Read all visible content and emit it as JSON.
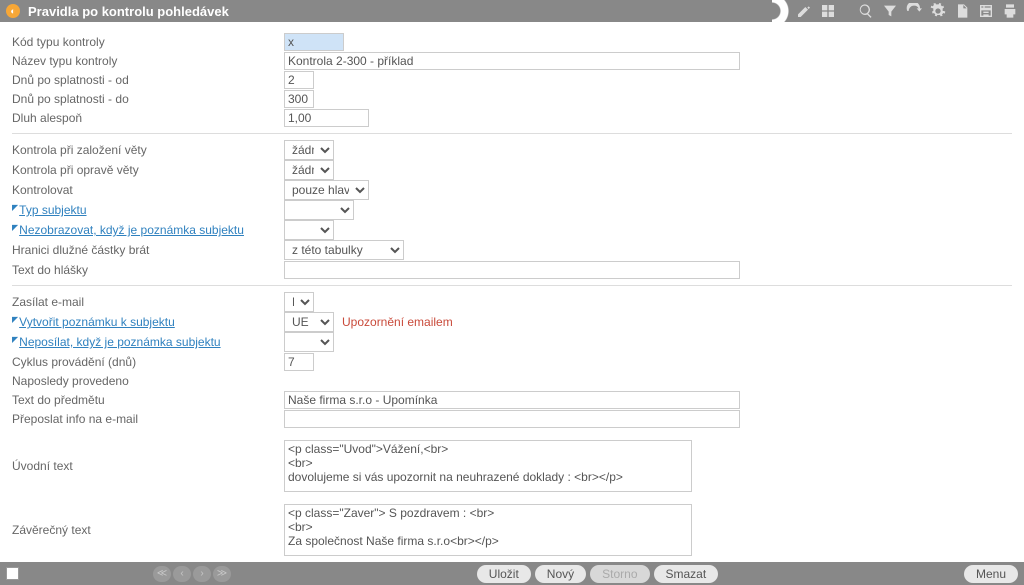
{
  "header": {
    "title": "Pravidla po kontrolu pohledávek"
  },
  "fields": {
    "kod_typu_label": "Kód typu kontroly",
    "kod_typu_value": "x",
    "nazev_typu_label": "Název typu kontroly",
    "nazev_typu_value": "Kontrola 2-300 - příklad",
    "dnu_od_label": "Dnů po splatnosti - od",
    "dnu_od_value": "2",
    "dnu_do_label": "Dnů po splatnosti - do",
    "dnu_do_value": "300",
    "dluh_label": "Dluh alespoň",
    "dluh_value": "1,00",
    "kontrola_zalozeni_label": "Kontrola při založení věty",
    "kontrola_zalozeni_value": "žádná",
    "kontrola_oprave_label": "Kontrola při opravě věty",
    "kontrola_oprave_value": "žádná",
    "kontrolovat_label": "Kontrolovat",
    "kontrolovat_value": "pouze hlavičky",
    "typ_subjektu_label": "Typ subjektu",
    "nezobrazovat_label": "Nezobrazovat, když je poznámka subjektu",
    "hranici_label": "Hranici dlužné částky brát",
    "hranici_value": "z této tabulky",
    "text_hlasky_label": "Text do hlášky",
    "text_hlasky_value": "",
    "zasilat_label": "Zasílat e-mail",
    "zasilat_value": "Ne",
    "vytvorit_label": "Vytvořit poznámku k subjektu",
    "vytvorit_value": "UE",
    "vytvorit_desc": "Upozornění emailem",
    "neposilat_label": "Neposílat, když je poznámka subjektu",
    "cyklus_label": "Cyklus provádění (dnů)",
    "cyklus_value": "7",
    "naposledy_label": "Naposledy provedeno",
    "text_predmet_label": "Text do předmětu",
    "text_predmet_value": "Naše firma s.r.o - Upomínka",
    "preposlat_label": "Přeposlat info na e-mail",
    "preposlat_value": "",
    "uvodni_label": "Úvodní text",
    "uvodni_value": "<p class=\"Uvod\">Vážení,<br>\n<br>\ndovolujeme si vás upozornit na neuhrazené doklady : <br></p>",
    "zaverecny_label": "Závěrečný text",
    "zaverecny_value": "<p class=\"Zaver\"> S pozdravem : <br>\n<br>\nZa společnost Naše firma s.r.o<br></p>"
  },
  "footer": {
    "save": "Uložit",
    "new": "Nový",
    "cancel": "Storno",
    "delete": "Smazat",
    "menu": "Menu"
  }
}
